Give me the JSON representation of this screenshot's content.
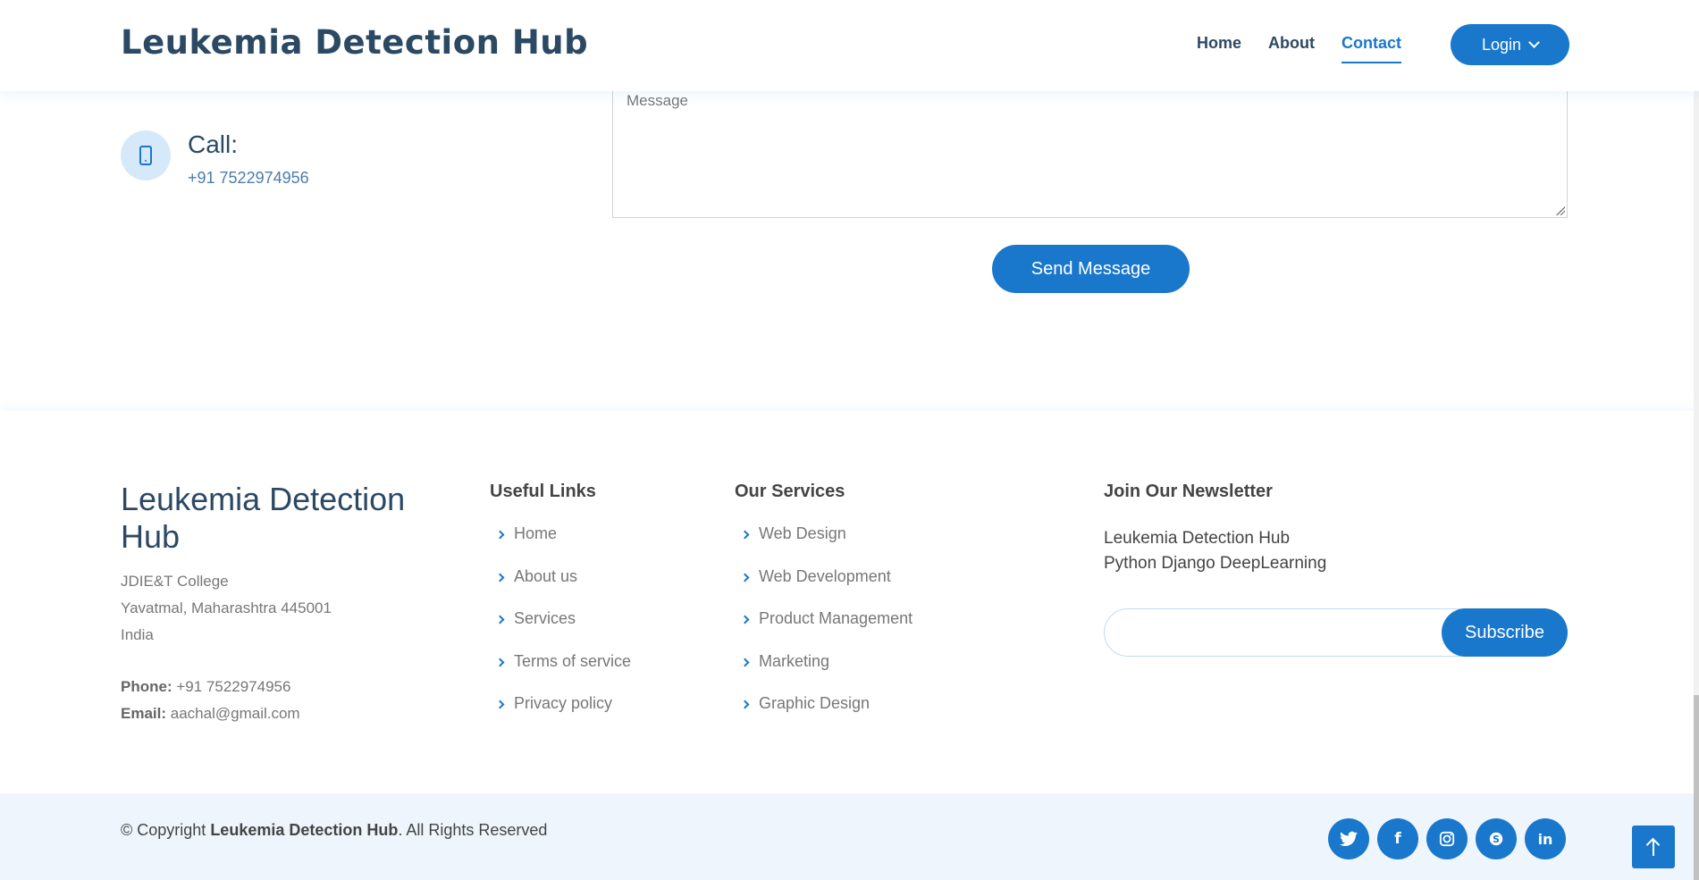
{
  "header": {
    "brand": "Leukemia Detection Hub",
    "nav": [
      {
        "label": "Home",
        "active": false
      },
      {
        "label": "About",
        "active": false
      },
      {
        "label": "Contact",
        "active": true
      }
    ],
    "login_label": "Login",
    "accent": "#1977cc"
  },
  "contact": {
    "call_title": "Call:",
    "call_phone": "+91 7522974956",
    "message_placeholder": "Message",
    "send_label": "Send Message"
  },
  "footer": {
    "brand": "Leukemia Detection Hub",
    "address_lines": [
      "JDIE&T College",
      "Yavatmal, Maharashtra 445001",
      "India"
    ],
    "phone_label": "Phone:",
    "phone": "+91 7522974956",
    "email_label": "Email:",
    "email": "aachal@gmail.com",
    "useful_links_title": "Useful Links",
    "useful_links": [
      "Home",
      "About us",
      "Services",
      "Terms of service",
      "Privacy policy"
    ],
    "services_title": "Our Services",
    "services": [
      "Web Design",
      "Web Development",
      "Product Management",
      "Marketing",
      "Graphic Design"
    ],
    "newsletter_title": "Join Our Newsletter",
    "newsletter_lines": [
      "Leukemia Detection Hub",
      "Python Django DeepLearning"
    ],
    "subscribe_label": "Subscribe"
  },
  "bottom": {
    "copyright_prefix": "© Copyright ",
    "copyright_brand": "Leukemia Detection Hub",
    "copyright_suffix": ". All Rights Reserved",
    "social_icons": [
      "twitter-icon",
      "facebook-icon",
      "instagram-icon",
      "skype-icon",
      "linkedin-icon"
    ]
  }
}
